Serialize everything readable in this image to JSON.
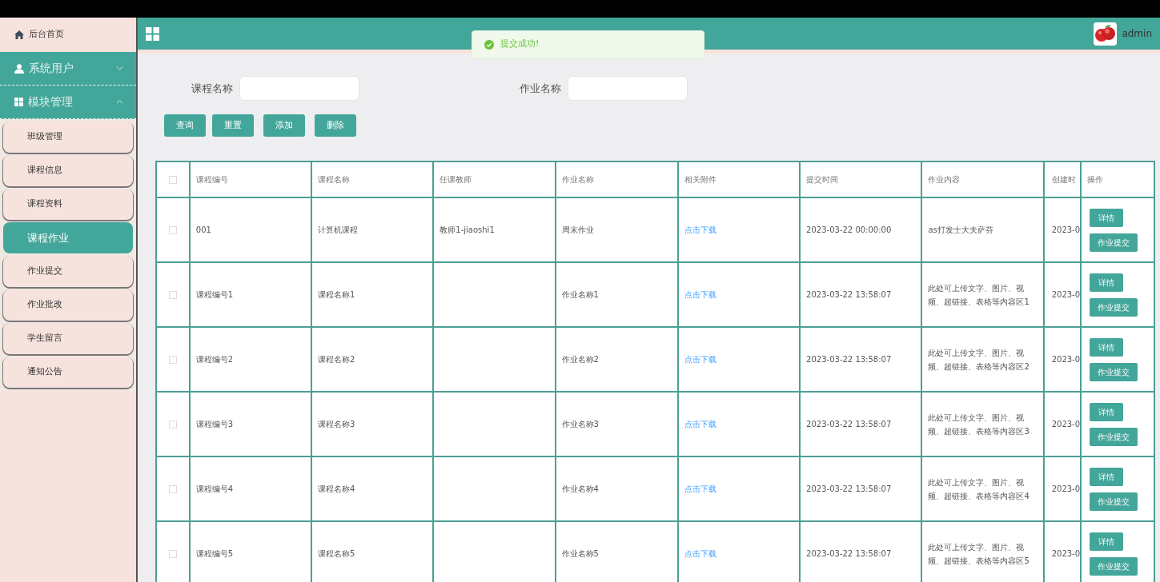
{
  "sidebar": {
    "home": {
      "label": "后台首页"
    },
    "groups": [
      {
        "label": "系统用户",
        "expanded": false
      },
      {
        "label": "模块管理",
        "expanded": true,
        "items": [
          {
            "label": "班级管理",
            "selected": false
          },
          {
            "label": "课程信息",
            "selected": false
          },
          {
            "label": "课程资料",
            "selected": false
          },
          {
            "label": "课程作业",
            "selected": true
          },
          {
            "label": "作业提交",
            "selected": false
          },
          {
            "label": "作业批改",
            "selected": false
          },
          {
            "label": "学生留言",
            "selected": false
          },
          {
            "label": "通知公告",
            "selected": false
          }
        ]
      }
    ]
  },
  "header": {
    "user": "admin"
  },
  "toast": {
    "message": "提交成功!",
    "kind": "success"
  },
  "search": {
    "fields": [
      {
        "label": "课程名称"
      },
      {
        "label": "作业名称"
      }
    ],
    "buttons": [
      "查询",
      "重置",
      "添加",
      "删除"
    ]
  },
  "table": {
    "all_checked": false,
    "columns": [
      "课程编号",
      "课程名称",
      "任课教师",
      "作业名称",
      "相关附件",
      "提交时间",
      "作业内容",
      "创建时",
      "操作"
    ],
    "rows": [
      {
        "checked": false,
        "cells": [
          "001",
          "计算机课程",
          "教师1-jiaoshi1",
          "周末作业",
          "点击下载",
          "2023-03-22 00:00:00",
          "as打发士大夫萨芬",
          "2023-0"
        ],
        "actions": [
          "详情",
          "作业提交"
        ]
      },
      {
        "checked": false,
        "cells": [
          "课程编号1",
          "课程名称1",
          "",
          "作业名称1",
          "点击下载",
          "2023-03-22 13:58:07",
          "此处可上传文字、图片、视频、超链接、表格等内容区1",
          "2023-0"
        ],
        "actions": [
          "详情",
          "作业提交"
        ]
      },
      {
        "checked": false,
        "cells": [
          "课程编号2",
          "课程名称2",
          "",
          "作业名称2",
          "点击下载",
          "2023-03-22 13:58:07",
          "此处可上传文字、图片、视频、超链接、表格等内容区2",
          "2023-0"
        ],
        "actions": [
          "详情",
          "作业提交"
        ]
      },
      {
        "checked": false,
        "cells": [
          "课程编号3",
          "课程名称3",
          "",
          "作业名称3",
          "点击下载",
          "2023-03-22 13:58:07",
          "此处可上传文字、图片、视频、超链接、表格等内容区3",
          "2023-0"
        ],
        "actions": [
          "详情",
          "作业提交"
        ]
      },
      {
        "checked": false,
        "cells": [
          "课程编号4",
          "课程名称4",
          "",
          "作业名称4",
          "点击下载",
          "2023-03-22 13:58:07",
          "此处可上传文字、图片、视频、超链接、表格等内容区4",
          "2023-0"
        ],
        "actions": [
          "详情",
          "作业提交"
        ]
      },
      {
        "checked": false,
        "cells": [
          "课程编号5",
          "课程名称5",
          "",
          "作业名称5",
          "点击下载",
          "2023-03-22 13:58:07",
          "此处可上传文字、图片、视频、超链接、表格等内容区5",
          "2023-0"
        ],
        "actions": [
          "详情",
          "作业提交"
        ]
      }
    ]
  }
}
